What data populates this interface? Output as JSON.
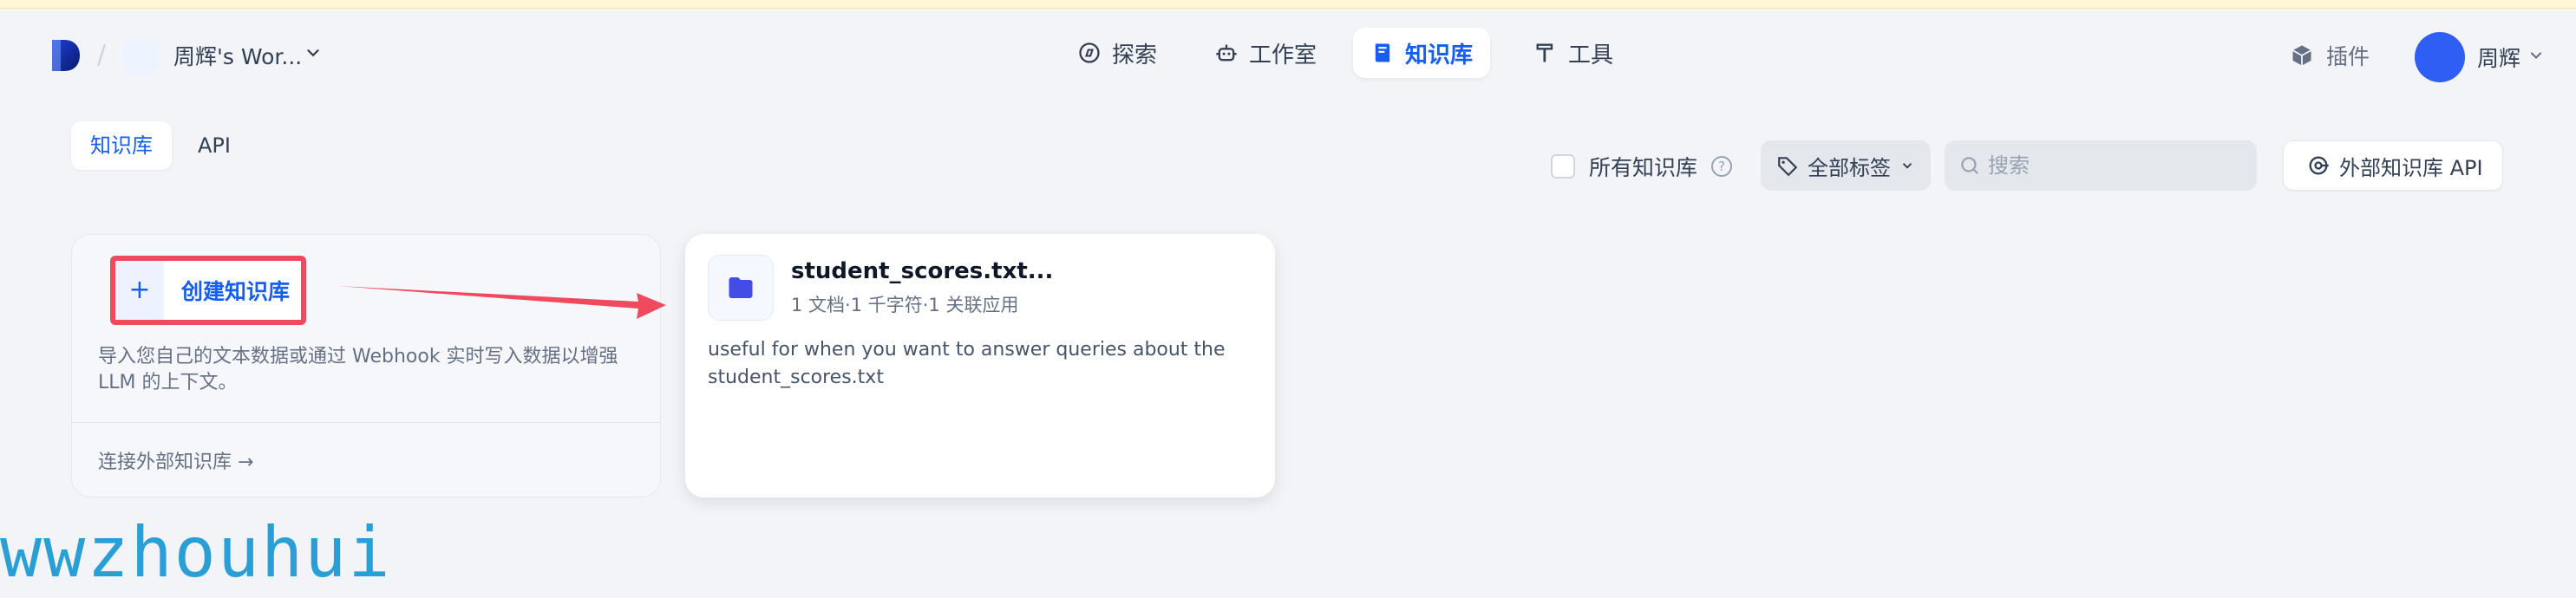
{
  "header": {
    "workspace_name": "周辉's Wor...",
    "nav": [
      {
        "label": "探索",
        "icon": "compass-icon"
      },
      {
        "label": "工作室",
        "icon": "robot-icon"
      },
      {
        "label": "知识库",
        "icon": "book-icon",
        "active": true
      },
      {
        "label": "工具",
        "icon": "hammer-icon"
      }
    ],
    "plugin_label": "插件",
    "user_name": "周辉"
  },
  "tabs": [
    {
      "label": "知识库",
      "active": true
    },
    {
      "label": "API",
      "active": false
    }
  ],
  "toolbar": {
    "all_kb_label": "所有知识库",
    "help_glyph": "?",
    "tags_label": "全部标签",
    "search_placeholder": "搜索",
    "external_api_label": "外部知识库 API"
  },
  "create_card": {
    "plus": "+",
    "create_label": "创建知识库",
    "description": "导入您自己的文本数据或通过 Webhook 实时写入数据以增强 LLM 的上下文。",
    "connect_external": "连接外部知识库 →"
  },
  "datasets": [
    {
      "name": "student_scores.txt...",
      "meta": "1 文档·1 千字符·1 关联应用",
      "description": "useful for when you want to answer queries about the student_scores.txt"
    }
  ],
  "watermark": "wwzhouhui",
  "colors": {
    "accent": "#155eef",
    "highlight_border": "#f04a5e",
    "background": "#f2f4f7",
    "watermark": "#2a9fd6"
  }
}
